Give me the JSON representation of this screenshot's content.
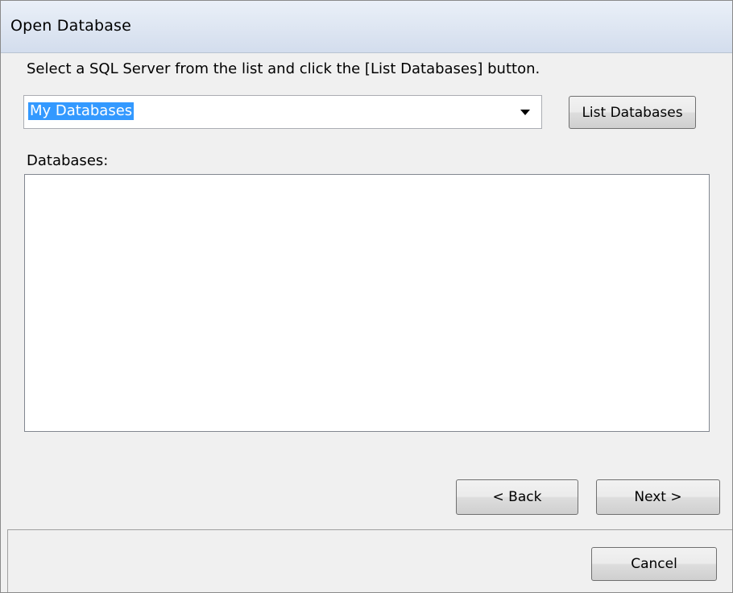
{
  "window": {
    "title": "Open Database"
  },
  "instruction": "Select a SQL Server from the list and click the [List Databases] button.",
  "server_combo": {
    "value": "My Databases",
    "icon": "chevron-down-icon"
  },
  "buttons": {
    "list_databases": "List Databases",
    "back": "< Back",
    "next": "Next >",
    "cancel": "Cancel"
  },
  "databases": {
    "label": "Databases:",
    "items": []
  },
  "colors": {
    "selection": "#3399ff",
    "titlebar": "#dde5f0",
    "dialog_bg": "#f0f0f0"
  }
}
